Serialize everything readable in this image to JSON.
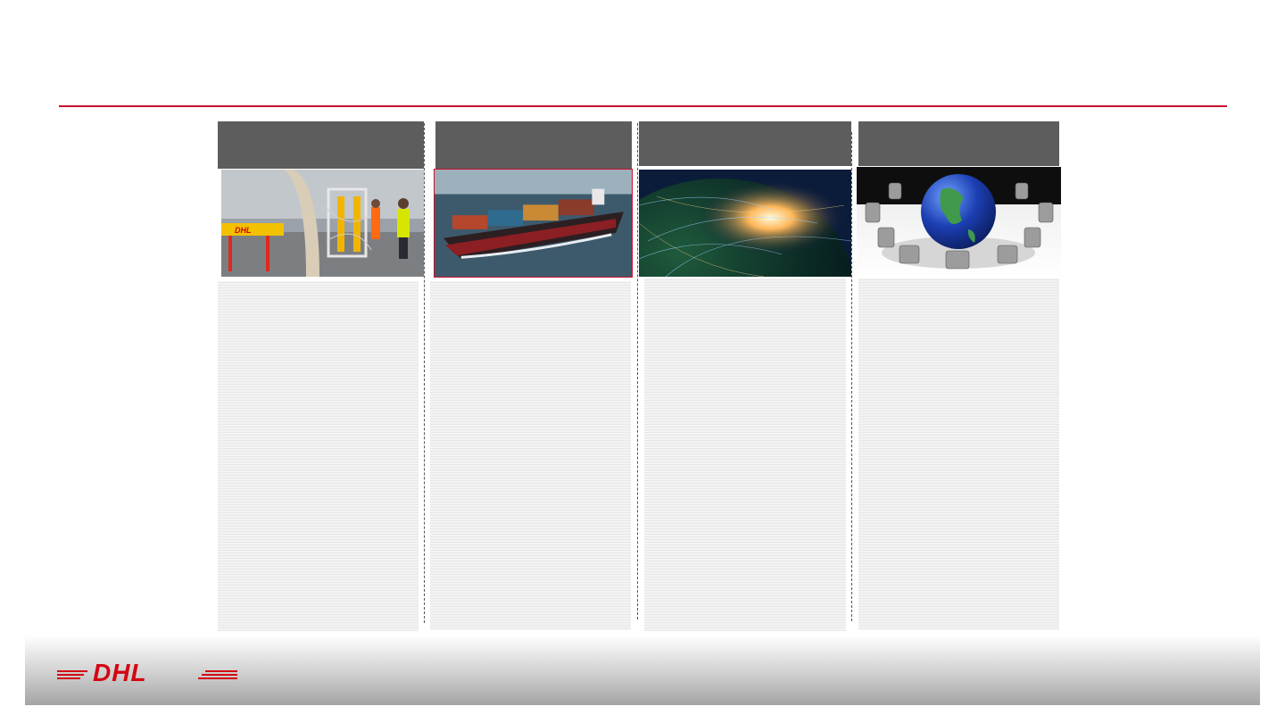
{
  "header": {
    "title": ""
  },
  "columns": [
    {
      "id": "air",
      "image": "air-cargo-photo"
    },
    {
      "id": "ocean",
      "image": "container-ship-photo"
    },
    {
      "id": "network",
      "image": "global-network-photo"
    },
    {
      "id": "meeting",
      "image": "globe-meeting-photo"
    }
  ],
  "brand": {
    "logo_text": "DHL",
    "logo_color": "#d40511",
    "accent": "#c8102e"
  }
}
